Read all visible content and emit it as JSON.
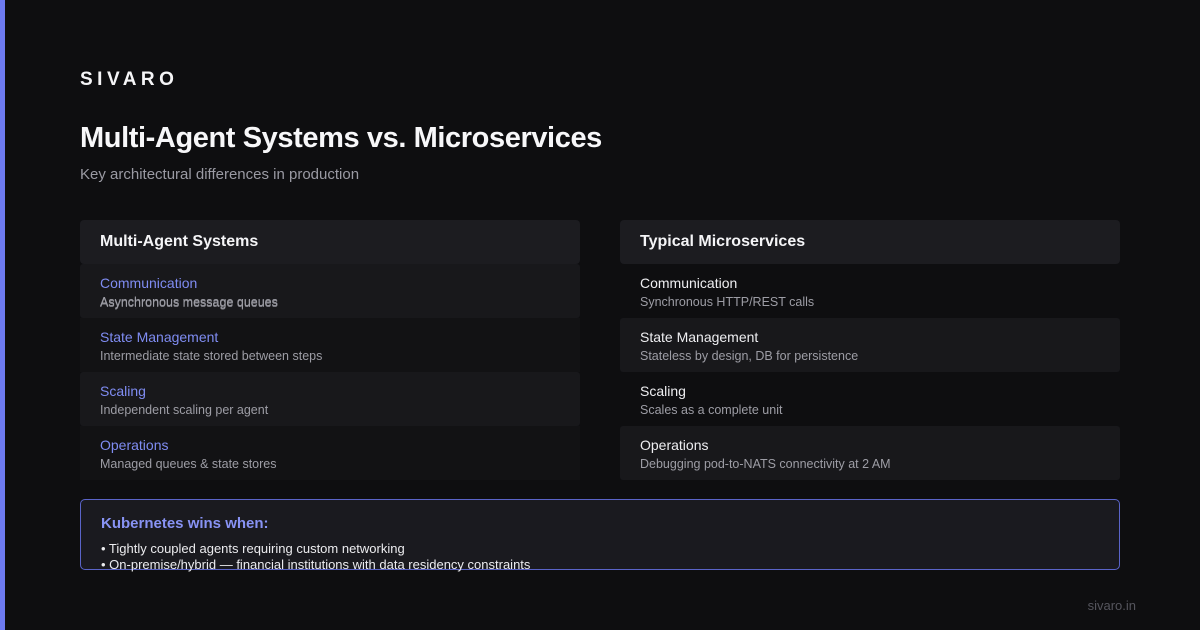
{
  "brand": "SIVARO",
  "title": "Multi-Agent Systems vs. Microservices",
  "subtitle": "Key architectural differences in production",
  "left": {
    "header": "Multi-Agent Systems",
    "rows": [
      {
        "label": "Communication",
        "desc": "Asynchronous message queues"
      },
      {
        "label": "State Management",
        "desc": "Intermediate state stored between steps"
      },
      {
        "label": "Scaling",
        "desc": "Independent scaling per agent"
      },
      {
        "label": "Operations",
        "desc": "Managed queues & state stores"
      }
    ]
  },
  "right": {
    "header": "Typical Microservices",
    "rows": [
      {
        "label": "Communication",
        "desc": "Synchronous HTTP/REST calls"
      },
      {
        "label": "State Management",
        "desc": "Stateless by design, DB for persistence"
      },
      {
        "label": "Scaling",
        "desc": "Scales as a complete unit"
      },
      {
        "label": "Operations",
        "desc": "Debugging pod-to-NATS connectivity at 2 AM"
      }
    ]
  },
  "wins": {
    "title": "Kubernetes wins when:",
    "items": [
      "• Tightly coupled agents requiring custom networking",
      "• On-premise/hybrid — financial institutions with data residency constraints"
    ]
  },
  "footer": "sivaro.in",
  "colors": {
    "accent": "#6d7af0",
    "background": "#0e0e10",
    "label_accent": "#7f8cf2"
  }
}
